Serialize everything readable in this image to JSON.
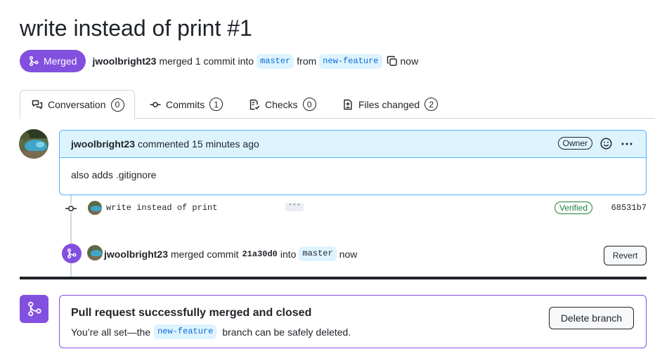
{
  "pr": {
    "title": "write instead of print #1",
    "state_label": "Merged",
    "author": "jwoolbright23",
    "summary_mid": "merged 1 commit into",
    "base_branch": "master",
    "from_text": "from",
    "head_branch": "new-feature",
    "time": "now"
  },
  "tabs": [
    {
      "label": "Conversation",
      "count": "0",
      "icon": "comment-discussion-icon"
    },
    {
      "label": "Commits",
      "count": "1",
      "icon": "git-commit-icon"
    },
    {
      "label": "Checks",
      "count": "0",
      "icon": "checklist-icon"
    },
    {
      "label": "Files changed",
      "count": "2",
      "icon": "file-diff-icon"
    }
  ],
  "comment": {
    "author": "jwoolbright23",
    "action": "commented 15 minutes ago",
    "badge": "Owner",
    "body": "also adds .gitignore"
  },
  "commit": {
    "message": "write instead of print",
    "ellipsis": "···",
    "verified": "Verified",
    "sha": "68531b7"
  },
  "merge_event": {
    "author": "jwoolbright23",
    "action": "merged commit",
    "sha": "21a30d0",
    "into": "into",
    "branch": "master",
    "time": "now",
    "revert_label": "Revert"
  },
  "merged_box": {
    "heading": "Pull request successfully merged and closed",
    "desc_before": "You’re all set—the",
    "branch": "new-feature",
    "desc_after": "branch can be safely deleted.",
    "delete_label": "Delete branch"
  },
  "colors": {
    "merged_purple": "#8250df",
    "link_blue": "#0969da",
    "comment_header_bg": "#ddf4ff",
    "verified_green": "#1a7f37"
  }
}
